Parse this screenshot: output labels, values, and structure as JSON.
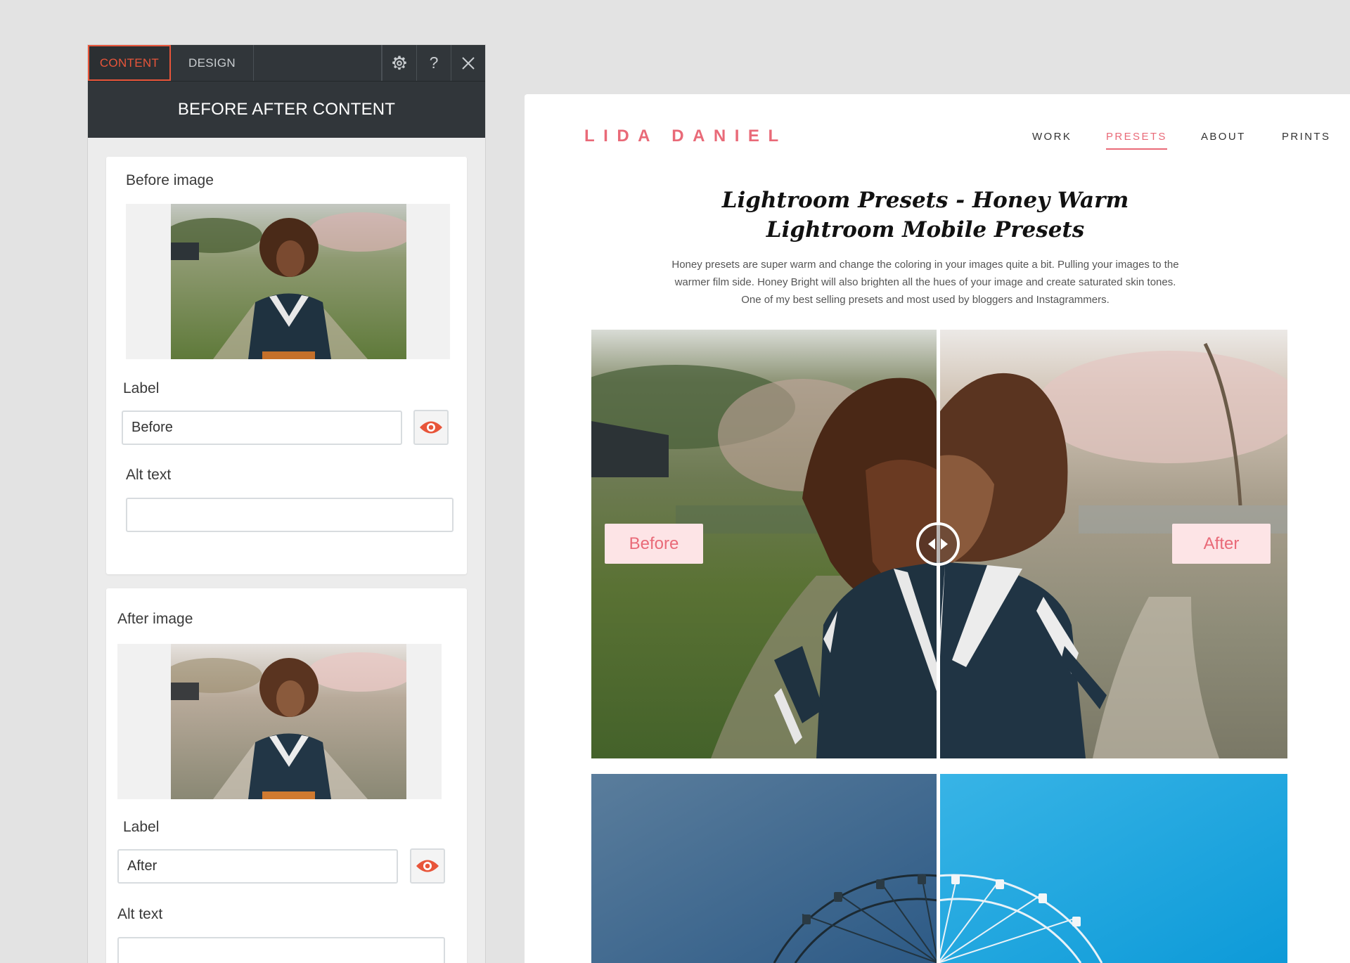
{
  "editor": {
    "tabs": [
      {
        "label": "CONTENT",
        "active": true
      },
      {
        "label": "DESIGN",
        "active": false
      }
    ],
    "tools": [
      "gear-icon",
      "help-icon",
      "close-icon"
    ],
    "help_label": "?",
    "title": "BEFORE AFTER CONTENT",
    "before_card": {
      "heading": "Before image",
      "label_title": "Label",
      "label_value": "Before",
      "alt_title": "Alt text",
      "alt_value": ""
    },
    "after_card": {
      "heading": "After image",
      "label_title": "Label",
      "label_value": "After",
      "alt_title": "Alt text",
      "alt_value": ""
    },
    "accent_color": "#e8553a"
  },
  "site": {
    "logo": "LIDA DANIEL",
    "nav": [
      {
        "label": "WORK",
        "active": false
      },
      {
        "label": "PRESETS",
        "active": true
      },
      {
        "label": "ABOUT",
        "active": false
      },
      {
        "label": "PRINTS",
        "active": false
      }
    ],
    "heading": "Lightroom Presets - Honey Warm Lightroom Mobile Presets",
    "description": "Honey presets are super warm and change the coloring in your images quite a bit. Pulling your images to the warmer film side. Honey Bright will also brighten all the hues of your image and create saturated skin tones. One of my best selling presets and most used by bloggers and Instagrammers.",
    "compare": {
      "before_label": "Before",
      "after_label": "After"
    },
    "brand_color": "#e96a78"
  }
}
